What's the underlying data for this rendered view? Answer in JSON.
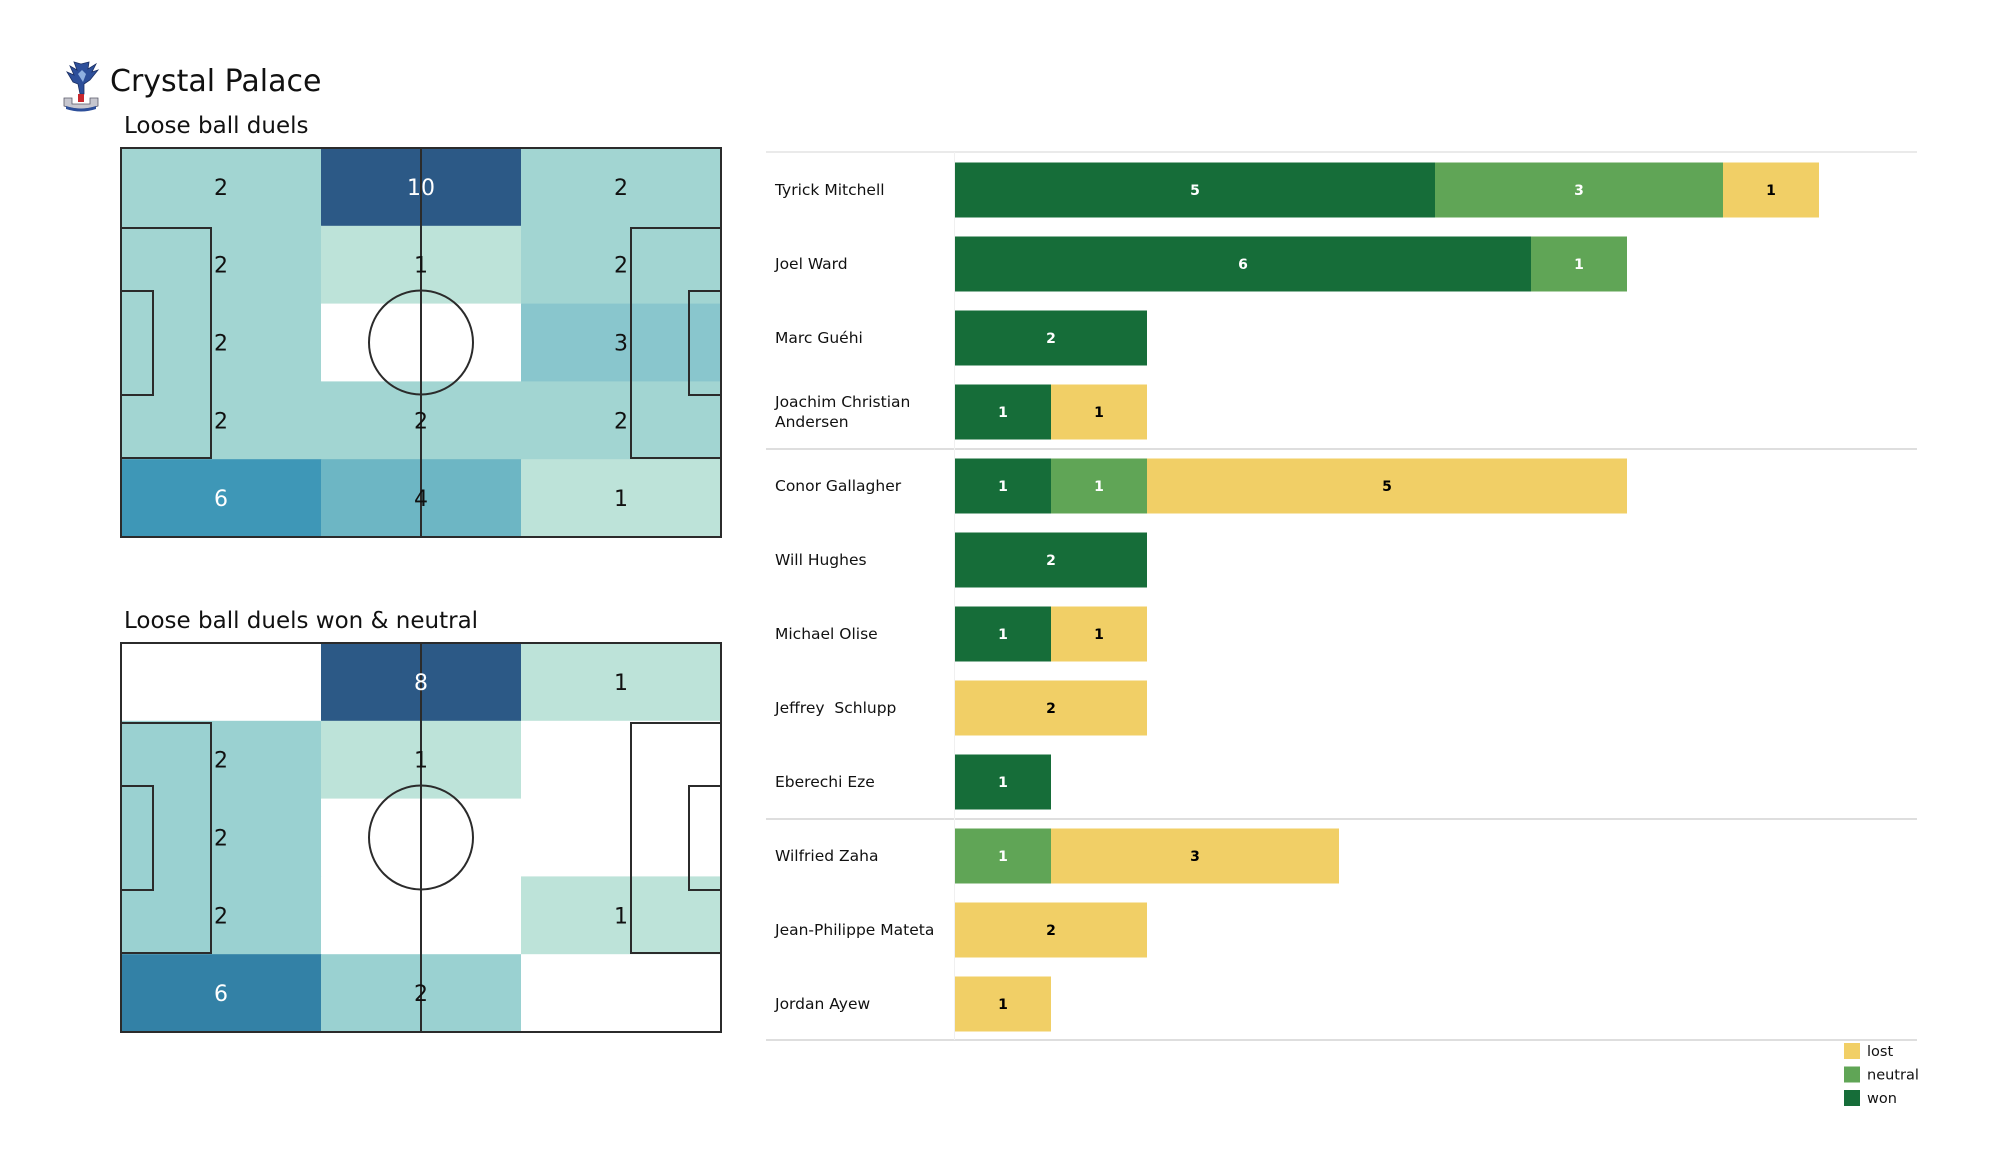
{
  "header": {
    "team_name": "Crystal Palace",
    "logo_icon": "crystal-palace-eagle-crest"
  },
  "chart_data": [
    {
      "type": "heatmap",
      "title": "Loose ball duels",
      "grid": {
        "rows": 5,
        "cols": 3
      },
      "values": [
        [
          2,
          10,
          2
        ],
        [
          2,
          1,
          2
        ],
        [
          2,
          null,
          3
        ],
        [
          2,
          2,
          2
        ],
        [
          6,
          4,
          1
        ]
      ],
      "colorscale": {
        "min": 1,
        "max": 10,
        "colors": [
          "#bde3d9",
          "#a2d5d2",
          "#89c6cd",
          "#6db6c4",
          "#3e97b7",
          "#2c5986"
        ]
      },
      "background": "pitch"
    },
    {
      "type": "heatmap",
      "title": "Loose ball duels won & neutral",
      "grid": {
        "rows": 5,
        "cols": 3
      },
      "values": [
        [
          null,
          8,
          1
        ],
        [
          2,
          1,
          null
        ],
        [
          2,
          null,
          null
        ],
        [
          2,
          null,
          1
        ],
        [
          6,
          2,
          null
        ]
      ],
      "colorscale": {
        "min": 1,
        "max": 8,
        "colors": [
          "#bde3d9",
          "#9ad1d1",
          "#3381a6",
          "#2c5986"
        ]
      },
      "background": "pitch"
    },
    {
      "type": "bar",
      "orientation": "horizontal",
      "stacked": true,
      "categories": [
        "Tyrick Mitchell",
        "Joel Ward",
        "Marc Guéhi",
        "Joachim Christian Andersen",
        "Conor Gallagher",
        "Will Hughes",
        "Michael Olise",
        "Jeffrey  Schlupp",
        "Eberechi Eze",
        "Wilfried Zaha",
        "Jean-Philippe Mateta",
        "Jordan Ayew"
      ],
      "category_display": [
        [
          "Tyrick Mitchell"
        ],
        [
          "Joel Ward"
        ],
        [
          "Marc Guéhi"
        ],
        [
          "Joachim Christian",
          "Andersen"
        ],
        [
          "Conor Gallagher"
        ],
        [
          "Will Hughes"
        ],
        [
          "Michael Olise"
        ],
        [
          "Jeffrey  Schlupp"
        ],
        [
          "Eberechi Eze"
        ],
        [
          "Wilfried Zaha"
        ],
        [
          "Jean-Philippe Mateta"
        ],
        [
          "Jordan Ayew"
        ]
      ],
      "groups": [
        [
          0,
          3
        ],
        [
          4,
          8
        ],
        [
          9,
          11
        ]
      ],
      "series": [
        {
          "name": "won",
          "color": "#166d39",
          "label_color": "#ffffff",
          "values": [
            5,
            6,
            2,
            1,
            1,
            2,
            1,
            0,
            1,
            0,
            0,
            0
          ]
        },
        {
          "name": "neutral",
          "color": "#60a556",
          "label_color": "#ffffff",
          "values": [
            3,
            1,
            0,
            0,
            1,
            0,
            0,
            0,
            0,
            1,
            0,
            0
          ]
        },
        {
          "name": "lost",
          "color": "#f1cf66",
          "label_color": "#000000",
          "values": [
            1,
            0,
            0,
            1,
            5,
            0,
            1,
            2,
            0,
            3,
            2,
            1
          ]
        }
      ],
      "xlim": [
        0,
        10
      ],
      "legend": {
        "position": "bottom-right",
        "entries": [
          "lost",
          "neutral",
          "won"
        ]
      },
      "title": "",
      "xlabel": "",
      "ylabel": ""
    }
  ]
}
